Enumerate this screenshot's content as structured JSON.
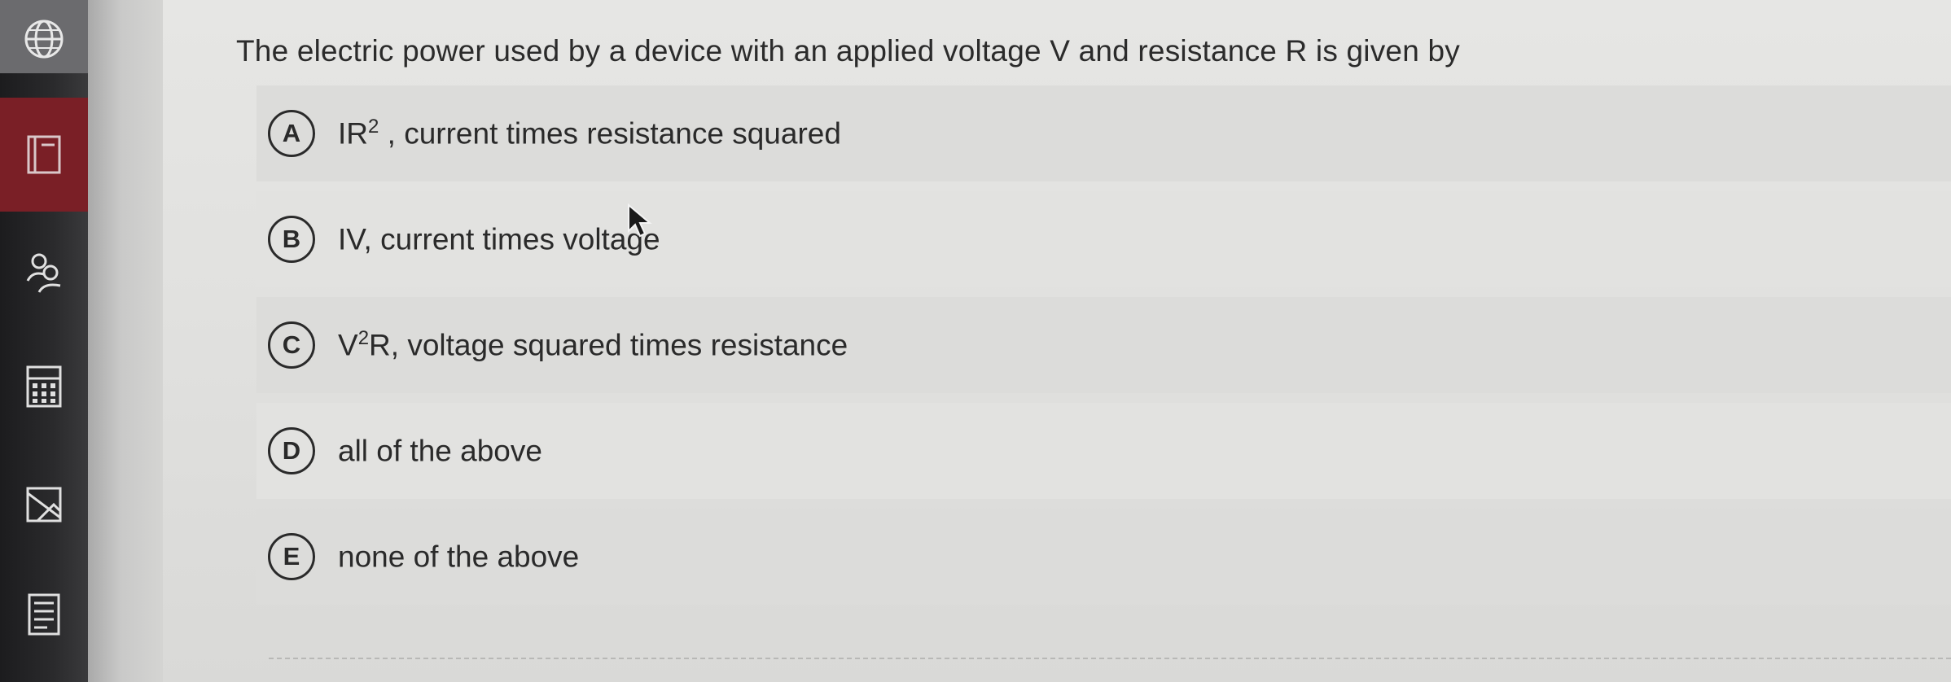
{
  "question": {
    "text": "The electric power used by a device with an applied voltage V and resistance R is given by"
  },
  "options": [
    {
      "letter": "A",
      "base": "IR",
      "sup": "2",
      "rest": " , current times resistance squared"
    },
    {
      "letter": "B",
      "base": "",
      "sup": "",
      "rest": "IV, current times voltage"
    },
    {
      "letter": "C",
      "base": "V",
      "sup": "2",
      "rest": "R, voltage squared times resistance"
    },
    {
      "letter": "D",
      "base": "",
      "sup": "",
      "rest": "all of the above"
    },
    {
      "letter": "E",
      "base": "",
      "sup": "",
      "rest": "none of the above"
    }
  ],
  "sidebar": {
    "icons": [
      "globe-icon",
      "book-icon",
      "people-icon",
      "calculator-icon",
      "image-icon",
      "document-icon"
    ]
  },
  "colors": {
    "text": "#2a2a2a",
    "sidebar": "#1c1c1e",
    "sidebar_accent": "#7a1f26"
  }
}
